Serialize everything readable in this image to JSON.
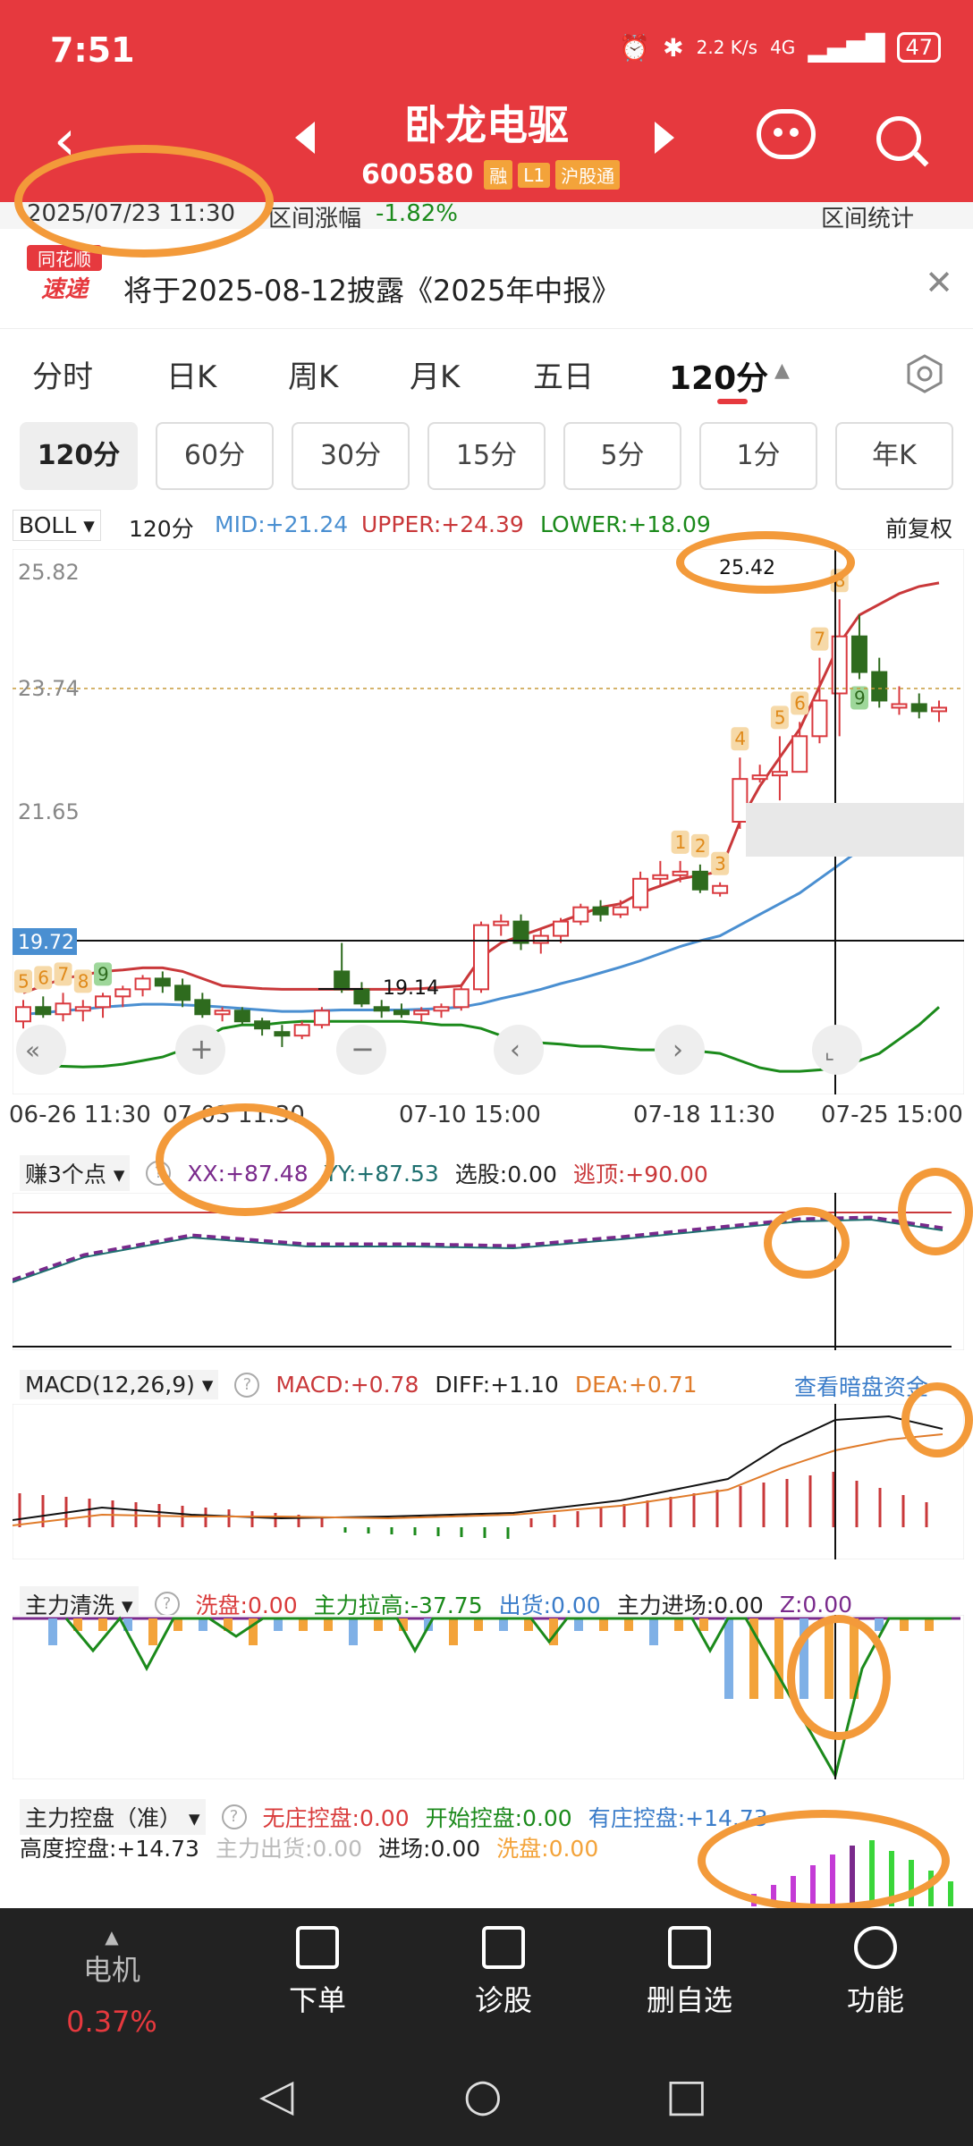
{
  "status": {
    "time": "7:51",
    "net_speed": "2.2 K/s",
    "signal": "4G",
    "battery": "47"
  },
  "header": {
    "stock_name": "卧龙电驱",
    "stock_code": "600580",
    "tags": [
      "融",
      "L1",
      "沪股通"
    ]
  },
  "subbar": {
    "date": "2025/07/23 11:30",
    "change_label": "区间涨幅",
    "change_value": "-1.82%",
    "range_stats": "区间统计"
  },
  "notice": {
    "logo_top": "同花顺",
    "logo_bottom": "速递",
    "text": "将于2025-08-12披露《2025年中报》"
  },
  "tabs": [
    "分时",
    "日K",
    "周K",
    "月K",
    "五日",
    "120分"
  ],
  "active_tab": "120分",
  "subtabs": [
    "120分",
    "60分",
    "30分",
    "15分",
    "5分",
    "1分",
    "年K"
  ],
  "boll": {
    "indicator": "BOLL",
    "period": "120分",
    "mid": "MID:+21.24",
    "upper": "UPPER:+24.39",
    "lower": "LOWER:+18.09",
    "adjust": "前复权"
  },
  "colors": {
    "up": "#d9393e",
    "down": "#2e6b1e",
    "mid": "#4a8fd1",
    "upper": "#c9383a",
    "lower": "#1b8a1b",
    "annotation": "#f39a3a"
  },
  "chart_data": [
    {
      "type": "candlestick",
      "title": "BOLL",
      "y_ticks": [
        "25.82",
        "23.74",
        "21.65"
      ],
      "ylim": [
        18.6,
        26.0
      ],
      "price_marker": "19.72",
      "max_label": "25.42",
      "min_label": "19.14",
      "x_ticks": [
        "06-26 11:30",
        "07-03 11:30",
        "07-10 15:00",
        "07-18 11:30",
        "07-25 15:00"
      ],
      "seq_labels": [
        {
          "i": 0,
          "t": "5"
        },
        {
          "i": 1,
          "t": "6"
        },
        {
          "i": 2,
          "t": "7"
        },
        {
          "i": 3,
          "t": "8"
        },
        {
          "i": 4,
          "t": "9"
        },
        {
          "i": 33,
          "t": "1"
        },
        {
          "i": 34,
          "t": "2"
        },
        {
          "i": 35,
          "t": "3"
        },
        {
          "i": 36,
          "t": "4"
        },
        {
          "i": 38,
          "t": "5"
        },
        {
          "i": 39,
          "t": "6"
        },
        {
          "i": 40,
          "t": "7"
        },
        {
          "i": 41,
          "t": "8"
        },
        {
          "i": 42,
          "t": "9"
        }
      ],
      "candles": [
        [
          19.5,
          19.8,
          19.4,
          19.7
        ],
        [
          19.7,
          19.85,
          19.55,
          19.6
        ],
        [
          19.6,
          19.9,
          19.5,
          19.75
        ],
        [
          19.65,
          19.8,
          19.5,
          19.7
        ],
        [
          19.7,
          19.9,
          19.55,
          19.85
        ],
        [
          19.85,
          20.0,
          19.7,
          19.95
        ],
        [
          19.95,
          20.15,
          19.85,
          20.1
        ],
        [
          20.1,
          20.2,
          19.9,
          20.0
        ],
        [
          20.0,
          20.1,
          19.7,
          19.8
        ],
        [
          19.8,
          19.9,
          19.55,
          19.6
        ],
        [
          19.6,
          19.7,
          19.5,
          19.65
        ],
        [
          19.65,
          19.7,
          19.45,
          19.5
        ],
        [
          19.5,
          19.55,
          19.3,
          19.4
        ],
        [
          19.35,
          19.45,
          19.14,
          19.3
        ],
        [
          19.3,
          19.5,
          19.25,
          19.45
        ],
        [
          19.45,
          19.7,
          19.4,
          19.65
        ],
        [
          20.2,
          20.6,
          19.9,
          19.95
        ],
        [
          19.95,
          20.05,
          19.7,
          19.75
        ],
        [
          19.7,
          19.8,
          19.55,
          19.65
        ],
        [
          19.65,
          19.75,
          19.55,
          19.6
        ],
        [
          19.6,
          19.7,
          19.5,
          19.65
        ],
        [
          19.65,
          19.75,
          19.55,
          19.7
        ],
        [
          19.7,
          20.0,
          19.65,
          19.95
        ],
        [
          19.95,
          20.9,
          19.9,
          20.85
        ],
        [
          20.85,
          21.0,
          20.7,
          20.9
        ],
        [
          20.9,
          21.0,
          20.5,
          20.6
        ],
        [
          20.6,
          20.8,
          20.45,
          20.7
        ],
        [
          20.7,
          20.95,
          20.6,
          20.9
        ],
        [
          20.9,
          21.15,
          20.85,
          21.1
        ],
        [
          21.1,
          21.2,
          20.9,
          21.0
        ],
        [
          21.0,
          21.2,
          20.95,
          21.1
        ],
        [
          21.1,
          21.6,
          21.05,
          21.5
        ],
        [
          21.5,
          21.75,
          21.4,
          21.55
        ],
        [
          21.55,
          21.75,
          21.45,
          21.6
        ],
        [
          21.6,
          21.7,
          21.3,
          21.35
        ],
        [
          21.3,
          21.45,
          21.25,
          21.4
        ],
        [
          22.3,
          23.2,
          22.2,
          22.9
        ],
        [
          22.9,
          23.1,
          22.85,
          22.95
        ],
        [
          22.95,
          23.5,
          22.6,
          23.0
        ],
        [
          23.0,
          23.7,
          23.0,
          23.5
        ],
        [
          23.5,
          24.6,
          23.4,
          24.0
        ],
        [
          24.1,
          25.42,
          23.5,
          24.9
        ],
        [
          24.9,
          25.2,
          24.3,
          24.4
        ],
        [
          24.4,
          24.6,
          23.9,
          24.0
        ],
        [
          23.9,
          24.2,
          23.8,
          23.95
        ],
        [
          23.95,
          24.1,
          23.75,
          23.85
        ],
        [
          23.85,
          24.0,
          23.7,
          23.9
        ]
      ],
      "mid": [
        19.6,
        19.62,
        19.65,
        19.67,
        19.7,
        19.72,
        19.74,
        19.74,
        19.73,
        19.72,
        19.7,
        19.68,
        19.66,
        19.64,
        19.64,
        19.65,
        19.66,
        19.66,
        19.66,
        19.66,
        19.67,
        19.68,
        19.7,
        19.75,
        19.82,
        19.88,
        19.95,
        20.03,
        20.1,
        20.18,
        20.26,
        20.35,
        20.45,
        20.55,
        20.63,
        20.7,
        20.85,
        21.0,
        21.15,
        21.3,
        21.5,
        21.7,
        21.9,
        22.05,
        22.2,
        22.35,
        22.5
      ],
      "upper": [
        19.9,
        20.0,
        20.1,
        20.15,
        20.2,
        20.22,
        20.25,
        20.25,
        20.2,
        20.1,
        20.0,
        19.98,
        19.96,
        19.95,
        19.95,
        19.95,
        19.95,
        19.95,
        19.95,
        19.95,
        19.96,
        19.98,
        20.0,
        20.4,
        20.6,
        20.7,
        20.8,
        20.9,
        21.0,
        21.1,
        21.15,
        21.3,
        21.4,
        21.5,
        21.55,
        21.6,
        22.3,
        22.8,
        23.2,
        23.6,
        24.2,
        24.8,
        25.2,
        25.35,
        25.5,
        25.6,
        25.65
      ],
      "lower": [
        18.9,
        18.88,
        18.87,
        18.86,
        18.87,
        18.9,
        18.95,
        19.0,
        19.1,
        19.25,
        19.4,
        19.45,
        19.45,
        19.48,
        19.5,
        19.5,
        19.5,
        19.5,
        19.5,
        19.5,
        19.48,
        19.45,
        19.45,
        19.4,
        19.3,
        19.25,
        19.2,
        19.18,
        19.15,
        19.15,
        19.12,
        19.1,
        19.1,
        19.1,
        19.08,
        19.05,
        18.95,
        18.85,
        18.8,
        18.8,
        18.82,
        18.85,
        18.95,
        19.05,
        19.25,
        19.45,
        19.7
      ]
    },
    {
      "type": "line",
      "title": "赚3个点",
      "series": [
        {
          "name": "XX",
          "value": "XX:+87.48"
        },
        {
          "name": "YY",
          "value": "YY:+87.53"
        }
      ],
      "extra": [
        "选股:0.00",
        "逃顶:+90.00"
      ]
    },
    {
      "type": "bar",
      "title": "MACD(12,26,9)",
      "series": [
        {
          "name": "MACD",
          "value": "MACD:+0.78"
        },
        {
          "name": "DIFF",
          "value": "DIFF:+1.10"
        },
        {
          "name": "DEA",
          "value": "DEA:+0.71"
        }
      ],
      "link": "查看暗盘资金"
    },
    {
      "type": "bar",
      "title": "主力清洗",
      "series": [
        {
          "name": "洗盘",
          "value": "洗盘:0.00"
        },
        {
          "name": "主力拉高",
          "value": "主力拉高:-37.75"
        },
        {
          "name": "出货",
          "value": "出货:0.00"
        },
        {
          "name": "主力进场",
          "value": "主力进场:0.00"
        },
        {
          "name": "Z",
          "value": "Z:0.00"
        }
      ]
    },
    {
      "type": "bar",
      "title": "主力控盘（准）",
      "series": [
        {
          "name": "无庄控盘",
          "value": "无庄控盘:0.00"
        },
        {
          "name": "开始控盘",
          "value": "开始控盘:0.00"
        },
        {
          "name": "有庄控盘",
          "value": "有庄控盘:+14.73"
        },
        {
          "name": "高度控盘",
          "value": "高度控盘:+14.73"
        },
        {
          "name": "主力出货",
          "value": "主力出货:0.00"
        },
        {
          "name": "进场",
          "value": "进场:0.00"
        },
        {
          "name": "洗盘",
          "value": "洗盘:0.00"
        }
      ]
    }
  ],
  "bottom_nav": {
    "sector_name": "电机",
    "sector_change": "0.37%",
    "items": [
      "下单",
      "诊股",
      "删自选",
      "功能"
    ]
  }
}
